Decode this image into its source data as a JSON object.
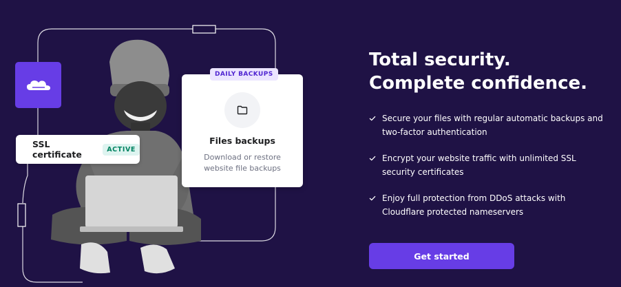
{
  "colors": {
    "background": "#1f1245",
    "accent": "#673de6",
    "frame_line": "#ffffff",
    "active_badge_bg": "#def4f0",
    "active_badge_text": "#008361",
    "backup_badge_bg": "#ebe4ff",
    "backup_badge_text": "#5025d1"
  },
  "illustration": {
    "cloud_tile_icon": "cloudflare-cloud-icon",
    "ssl_card": {
      "label": "SSL certificate",
      "status": "ACTIVE"
    },
    "backup_card": {
      "badge": "DAILY BACKUPS",
      "icon": "folder-icon",
      "title": "Files backups",
      "description": "Download or restore website file backups"
    }
  },
  "content": {
    "headline": "Total security. Complete confidence.",
    "features": [
      {
        "icon": "check-icon",
        "text": "Secure your files with regular automatic backups and two-factor authentication"
      },
      {
        "icon": "check-icon",
        "text": "Encrypt your website traffic with unlimited SSL security certificates"
      },
      {
        "icon": "check-icon",
        "text": "Enjoy full protection from DDoS attacks with Cloudflare protected nameservers"
      }
    ],
    "cta_label": "Get started"
  }
}
